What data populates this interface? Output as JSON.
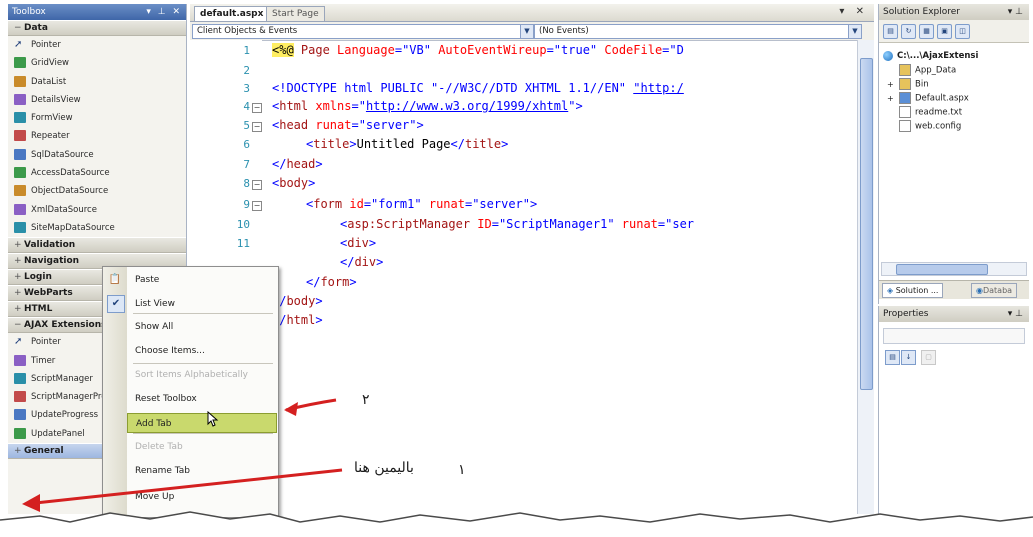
{
  "toolbox": {
    "title": "Toolbox",
    "title_controls": "▾ ⊥ ✕",
    "groups_top": [
      {
        "label": "Data",
        "toggle": "−"
      }
    ],
    "data_items": [
      {
        "label": "Pointer",
        "icon": "pointer-icon"
      },
      {
        "label": "GridView",
        "icon": "gridview-icon"
      },
      {
        "label": "DataList",
        "icon": "datalist-icon"
      },
      {
        "label": "DetailsView",
        "icon": "detailsview-icon"
      },
      {
        "label": "FormView",
        "icon": "formview-icon"
      },
      {
        "label": "Repeater",
        "icon": "repeater-icon"
      },
      {
        "label": "SqlDataSource",
        "icon": "sqldatasource-icon"
      },
      {
        "label": "AccessDataSource",
        "icon": "accessdatasource-icon"
      },
      {
        "label": "ObjectDataSource",
        "icon": "objectdatasource-icon"
      },
      {
        "label": "XmlDataSource",
        "icon": "xmldatasource-icon"
      },
      {
        "label": "SiteMapDataSource",
        "icon": "sitemapdatasource-icon"
      }
    ],
    "collapsed_groups": [
      {
        "label": "Validation",
        "toggle": "+"
      },
      {
        "label": "Navigation",
        "toggle": "+"
      },
      {
        "label": "Login",
        "toggle": "+"
      },
      {
        "label": "WebParts",
        "toggle": "+"
      },
      {
        "label": "HTML",
        "toggle": "+"
      },
      {
        "label": "AJAX Extensions",
        "toggle": "−"
      }
    ],
    "ajax_items": [
      {
        "label": "Pointer",
        "icon": "pointer-icon"
      },
      {
        "label": "Timer",
        "icon": "timer-icon"
      },
      {
        "label": "ScriptManager",
        "icon": "scriptmanager-icon"
      },
      {
        "label": "ScriptManagerProxy",
        "icon": "scriptmanagerproxy-icon"
      },
      {
        "label": "UpdateProgress",
        "icon": "updateprogress-icon"
      },
      {
        "label": "UpdatePanel",
        "icon": "updatepanel-icon"
      }
    ],
    "bottom_group": {
      "label": "General",
      "toggle": "+"
    }
  },
  "editor": {
    "tab_active": "default.aspx",
    "tab_inactive": "Start Page",
    "tab_controls": "▾ ✕",
    "left_dropdown": "Client Objects & Events",
    "right_dropdown": "(No Events)",
    "lines": [
      {
        "num": "1",
        "fold": ""
      },
      {
        "num": "2",
        "fold": ""
      },
      {
        "num": "3",
        "fold": ""
      },
      {
        "num": "4",
        "fold": "−"
      },
      {
        "num": "5",
        "fold": "−"
      },
      {
        "num": "6",
        "fold": ""
      },
      {
        "num": "7",
        "fold": ""
      },
      {
        "num": "8",
        "fold": "−"
      },
      {
        "num": "9",
        "fold": "−"
      },
      {
        "num": "10",
        "fold": ""
      },
      {
        "num": "11",
        "fold": ""
      }
    ],
    "code": {
      "l1_a": "<%@",
      "l1_b": " Page ",
      "l1_c": "Language",
      "l1_d": "=\"VB\" ",
      "l1_e": "AutoEventWireup",
      "l1_f": "=\"true\" ",
      "l1_g": "CodeFile",
      "l1_h": "=\"D",
      "l3_a": "<!DOCTYPE html PUBLIC ",
      "l3_b": "\"-//W3C//DTD XHTML 1.1//EN\" ",
      "l3_c": "\"http:/",
      "l4_a": "<",
      "l4_b": "html ",
      "l4_c": "xmlns",
      "l4_d": "=\"",
      "l4_e": "http://www.w3.org/1999/xhtml",
      "l4_f": "\">",
      "l5_a": "<",
      "l5_b": "head ",
      "l5_c": "runat",
      "l5_d": "=\"server\">",
      "l6_a": "<",
      "l6_b": "title",
      "l6_c": ">",
      "l6_d": "Untitled Page",
      "l6_e": "</",
      "l6_f": "title",
      "l6_g": ">",
      "l7_a": "</",
      "l7_b": "head",
      "l7_c": ">",
      "l8_a": "<",
      "l8_b": "body",
      "l8_c": ">",
      "l9_a": "<",
      "l9_b": "form ",
      "l9_c": "id",
      "l9_d": "=\"form1\" ",
      "l9_e": "runat",
      "l9_f": "=\"server\">",
      "l10_a": "<",
      "l10_b": "asp:ScriptManager ",
      "l10_c": "ID",
      "l10_d": "=\"ScriptManager1\" ",
      "l10_e": "runat",
      "l10_f": "=\"ser",
      "l11_a": "<",
      "l11_b": "div",
      "l11_c": ">",
      "l12_a": "</",
      "l12_b": "div",
      "l12_c": ">",
      "l13_a": "</",
      "l13_b": "form",
      "l13_c": ">",
      "l14_a": "</",
      "l14_b": "body",
      "l14_c": ">",
      "l15_a": "</",
      "l15_b": "html",
      "l15_c": ">"
    }
  },
  "solution_explorer": {
    "title": "Solution Explorer",
    "title_controls": "▾ ⊥",
    "root": "C:\\...\\AjaxExtensi",
    "nodes": [
      {
        "label": "App_Data",
        "toggle": "",
        "icon": "folder-icon"
      },
      {
        "label": "Bin",
        "toggle": "+",
        "icon": "folder-icon"
      },
      {
        "label": "Default.aspx",
        "toggle": "+",
        "icon": "aspx-file-icon"
      },
      {
        "label": "readme.txt",
        "toggle": "",
        "icon": "text-file-icon"
      },
      {
        "label": "web.config",
        "toggle": "",
        "icon": "config-file-icon"
      }
    ],
    "tab_solution": "Solution ...",
    "tab_other": "Databa"
  },
  "properties": {
    "title": "Properties",
    "title_controls": "▾ ⊥"
  },
  "context_menu": {
    "items": [
      {
        "label": "Paste",
        "state": "normal",
        "gutter": "paste"
      },
      {
        "label": "List View",
        "state": "normal",
        "gutter": "check"
      },
      {
        "label": "Show All",
        "state": "normal",
        "gutter": ""
      },
      {
        "label": "Choose Items...",
        "state": "normal",
        "gutter": ""
      },
      {
        "label": "Sort Items Alphabetically",
        "state": "disabled",
        "gutter": ""
      },
      {
        "label": "Reset Toolbox",
        "state": "normal",
        "gutter": ""
      },
      {
        "label": "Add Tab",
        "state": "highlighted",
        "gutter": ""
      },
      {
        "label": "Delete Tab",
        "state": "disabled",
        "gutter": ""
      },
      {
        "label": "Rename Tab",
        "state": "normal",
        "gutter": ""
      },
      {
        "label": "Move Up",
        "state": "normal",
        "gutter": ""
      }
    ]
  },
  "annotations": {
    "step2": "٢",
    "step1_text": "بالیمین هنا",
    "step1_num": "١",
    "arrow_color": "#d42020"
  }
}
